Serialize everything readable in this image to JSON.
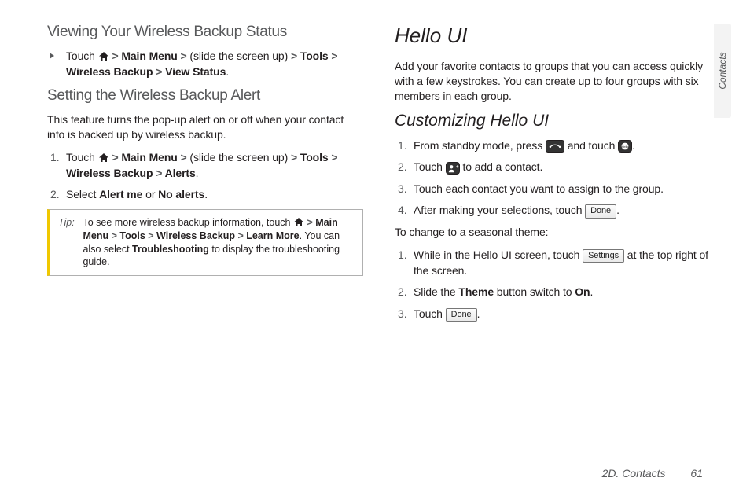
{
  "sideTab": "Contacts",
  "footer": {
    "section": "2D. Contacts",
    "page": "61"
  },
  "left": {
    "h_viewing": "Viewing Your Wireless Backup Status",
    "bullet": {
      "pre": "Touch ",
      "mid1": " > ",
      "b_mainmenu": "Main Menu",
      "mid2": " > ",
      "slide": "(slide the screen up)",
      "mid3": " > ",
      "b_tools": "Tools",
      "mid4": " > ",
      "b_wb": "Wireless Backup",
      "mid5": " > ",
      "b_vs": "View Status",
      "end": "."
    },
    "h_setting": "Setting the Wireless Backup Alert",
    "para": "This feature turns the pop-up alert on or off when your contact info is backed up by wireless backup.",
    "step1": {
      "pre": "Touch ",
      "mid1": " > ",
      "b_mainmenu": "Main Menu",
      "mid2": " > ",
      "slide": "(slide the screen up)",
      "mid3": " > ",
      "b_tools": "Tools",
      "mid4": " > ",
      "b_wb": "Wireless Backup",
      "mid5": " > ",
      "b_alerts": "Alerts",
      "end": "."
    },
    "step2": {
      "pre": "Select ",
      "b_alertme": "Alert me",
      "mid": " or ",
      "b_noalerts": "No alerts",
      "end": "."
    },
    "tip": {
      "label": "Tip:",
      "pre": "To see more wireless backup information, touch ",
      "mid1": " > ",
      "b_mainmenu": "Main Menu",
      "mid2": " > ",
      "b_tools": "Tools",
      "mid3": " > ",
      "b_wb": "Wireless Backup",
      "mid4": " > ",
      "b_lm": "Learn More",
      "end": ". You can also select ",
      "b_ts": "Troubleshooting",
      "end2": " to display the troubleshooting guide."
    }
  },
  "right": {
    "h_hello": "Hello UI",
    "para": "Add your favorite contacts to groups that you can access quickly with a few keystrokes. You can create up to four groups with six members in each group.",
    "h_custom": "Customizing Hello UI",
    "s1": {
      "pre": "From standby mode, press ",
      "mid": " and touch ",
      "end": "."
    },
    "s2": {
      "pre": "Touch ",
      "end": " to add a contact."
    },
    "s3": "Touch each contact you want to assign to the group.",
    "s4": {
      "pre": "After making your selections, touch ",
      "btn": "Done",
      "end": "."
    },
    "para2": "To change to a seasonal theme:",
    "t1": {
      "pre": "While in the Hello UI screen, touch ",
      "btn": "Settings",
      "end": " at the top right of the screen."
    },
    "t2": {
      "pre": "Slide the ",
      "b_theme": "Theme",
      "mid": " button switch to ",
      "b_on": "On",
      "end": "."
    },
    "t3": {
      "pre": "Touch ",
      "btn": "Done",
      "end": "."
    }
  }
}
